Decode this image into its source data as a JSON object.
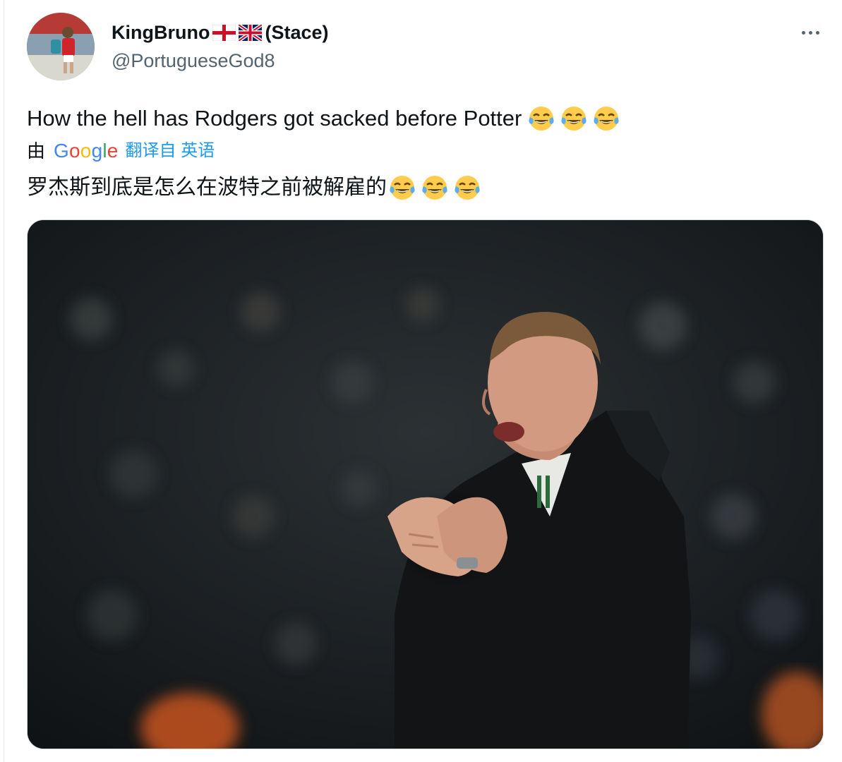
{
  "tweet": {
    "author": {
      "display_name": "KingBruno",
      "name_suffix": "(Stace)",
      "flags": [
        "england-flag",
        "uk-flag"
      ],
      "handle": "@PortugueseGod8",
      "avatar": "avatar-photo"
    },
    "menu_icon": "more-icon",
    "text": "How the hell has Rodgers got sacked before Potter",
    "text_emojis": [
      "face-with-tears-of-joy",
      "face-with-tears-of-joy",
      "face-with-tears-of-joy"
    ],
    "translation": {
      "prefix": "由",
      "provider": "Google",
      "link_label": "翻译自 英语",
      "text": "罗杰斯到底是怎么在波特之前被解雇的",
      "emojis": [
        "face-with-tears-of-joy",
        "face-with-tears-of-joy",
        "face-with-tears-of-joy"
      ]
    },
    "media": {
      "type": "photo",
      "subject": "football-manager-clapping"
    }
  },
  "colors": {
    "text": "#0f1419",
    "secondary": "#536471",
    "link": "#1d9bf0",
    "border": "#cfd9de"
  }
}
